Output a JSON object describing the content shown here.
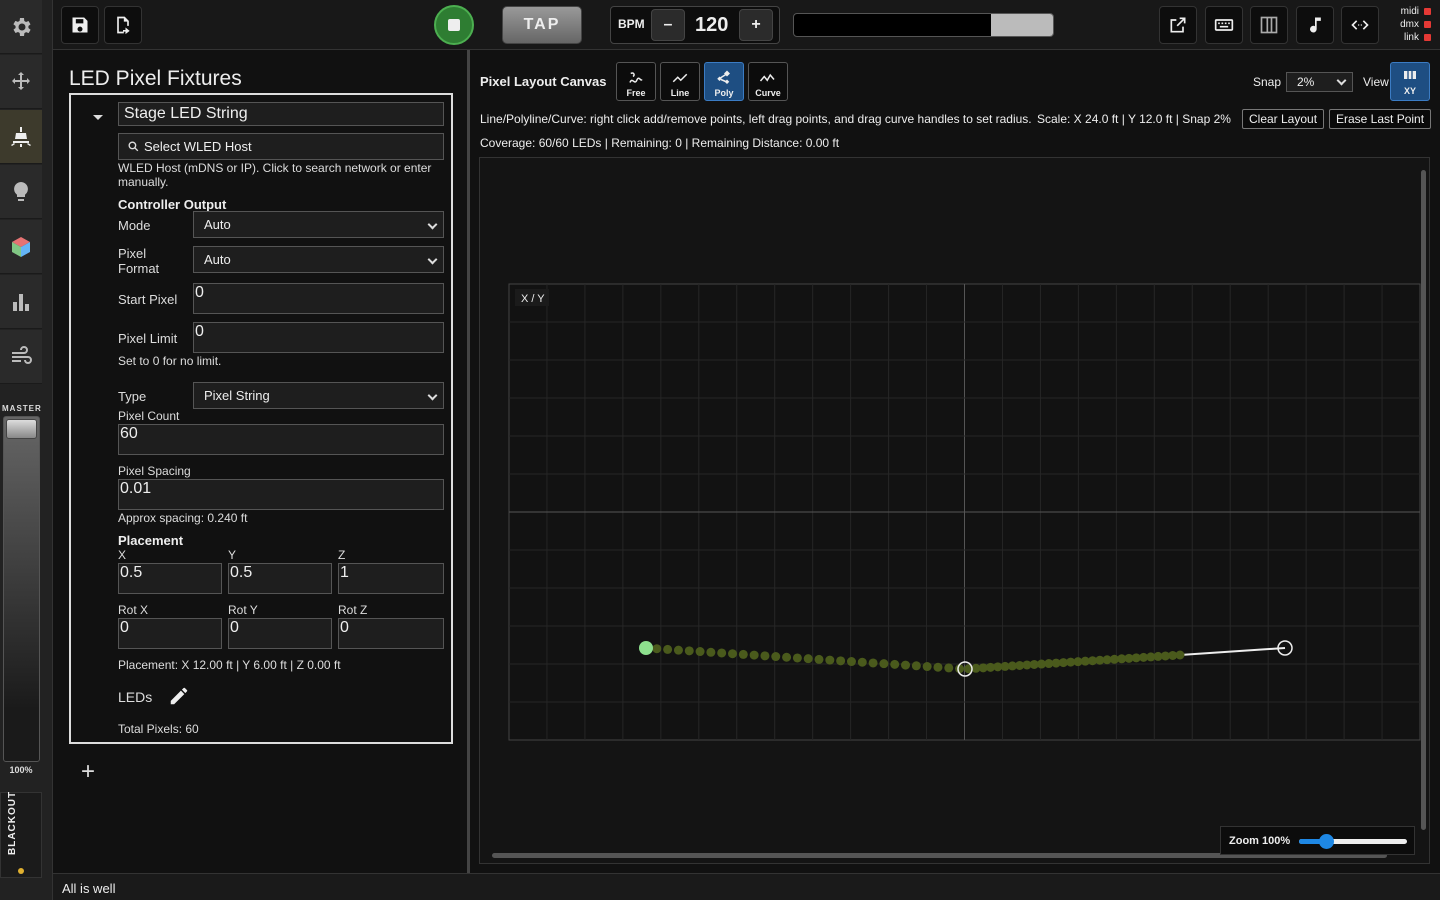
{
  "rail": {
    "items": [
      {
        "name": "settings",
        "icon": "gear-icon"
      },
      {
        "name": "move",
        "icon": "move-icon"
      },
      {
        "name": "led-pixels",
        "icon": "led-fixture-icon",
        "active": true
      },
      {
        "name": "lights",
        "icon": "bulb-icon"
      },
      {
        "name": "cube",
        "icon": "cube-icon"
      },
      {
        "name": "stats",
        "icon": "bar-chart-icon"
      },
      {
        "name": "wind",
        "icon": "wind-icon"
      }
    ],
    "master_label": "MASTER",
    "master_value": "100%",
    "master_level": 1.0,
    "blackout_label": "BLACKOUT"
  },
  "topbar": {
    "tap_label": "TAP",
    "bpm_label": "BPM",
    "bpm_value": "120",
    "bpm_minus": "–",
    "bpm_plus": "+",
    "beat_progress_start": 0.76,
    "status": [
      {
        "label": "midi",
        "color": "#e53935"
      },
      {
        "label": "dmx",
        "color": "#e53935"
      },
      {
        "label": "link",
        "color": "#e53935"
      }
    ]
  },
  "panel": {
    "title": "LED Pixel Fixtures",
    "fixture_name": "Stage LED String",
    "wled_button": "Select WLED Host",
    "wled_hint": "WLED Host (mDNS or IP). Click to search network or enter manually.",
    "controller_heading": "Controller Output",
    "mode_label": "Mode",
    "mode_value": "Auto",
    "pixel_format_label": "Pixel Format",
    "pixel_format_value": "Auto",
    "start_pixel_label": "Start Pixel",
    "start_pixel_value": "0",
    "pixel_limit_label": "Pixel Limit",
    "pixel_limit_value": "0",
    "pixel_limit_hint": "Set to 0 for no limit.",
    "type_label": "Type",
    "type_value": "Pixel String",
    "pixel_count_label": "Pixel Count",
    "pixel_count_value": "60",
    "pixel_spacing_label": "Pixel Spacing",
    "pixel_spacing_value": "0.01",
    "spacing_hint": "Approx spacing: 0.240 ft",
    "placement_heading": "Placement",
    "x_label": "X",
    "x_value": "0.5",
    "y_label": "Y",
    "y_value": "0.5",
    "z_label": "Z",
    "z_value": "1",
    "rotx_label": "Rot X",
    "rotx_value": "0",
    "roty_label": "Rot Y",
    "roty_value": "0",
    "rotz_label": "Rot Z",
    "rotz_value": "0",
    "placement_summary": "Placement: X 12.00 ft | Y 6.00 ft | Z 0.00 ft",
    "leds_label": "LEDs",
    "total_pixels": "Total Pixels: 60",
    "add_label": "+"
  },
  "canvas": {
    "title": "Pixel Layout Canvas",
    "modes": [
      {
        "label": "Free",
        "icon": "freehand-icon",
        "active": false
      },
      {
        "label": "Line",
        "icon": "line-icon",
        "active": false
      },
      {
        "label": "Poly",
        "icon": "polyline-icon",
        "active": true
      },
      {
        "label": "Curve",
        "icon": "curve-icon",
        "active": false
      }
    ],
    "snap_label": "Snap",
    "snap_value": "2%",
    "view_label": "View",
    "view_button": "XY",
    "help": "Line/Polyline/Curve: right click add/remove points, left drag points, and drag curve handles to set radius.",
    "scale": "Scale: X 24.0 ft | Y 12.0 ft | Snap 2%",
    "clear_button": "Clear Layout",
    "erase_button": "Erase Last Point",
    "coverage": "Coverage: 60/60 LEDs | Remaining: 0 | Remaining Distance: 0.00 ft",
    "plane_label": "X / Y",
    "zoom_label": "Zoom 100%",
    "zoom_level": 0.25,
    "led_color": "#4a5a1c",
    "start_point_color": "#8ee08e"
  },
  "footer": {
    "status": "All is well"
  }
}
